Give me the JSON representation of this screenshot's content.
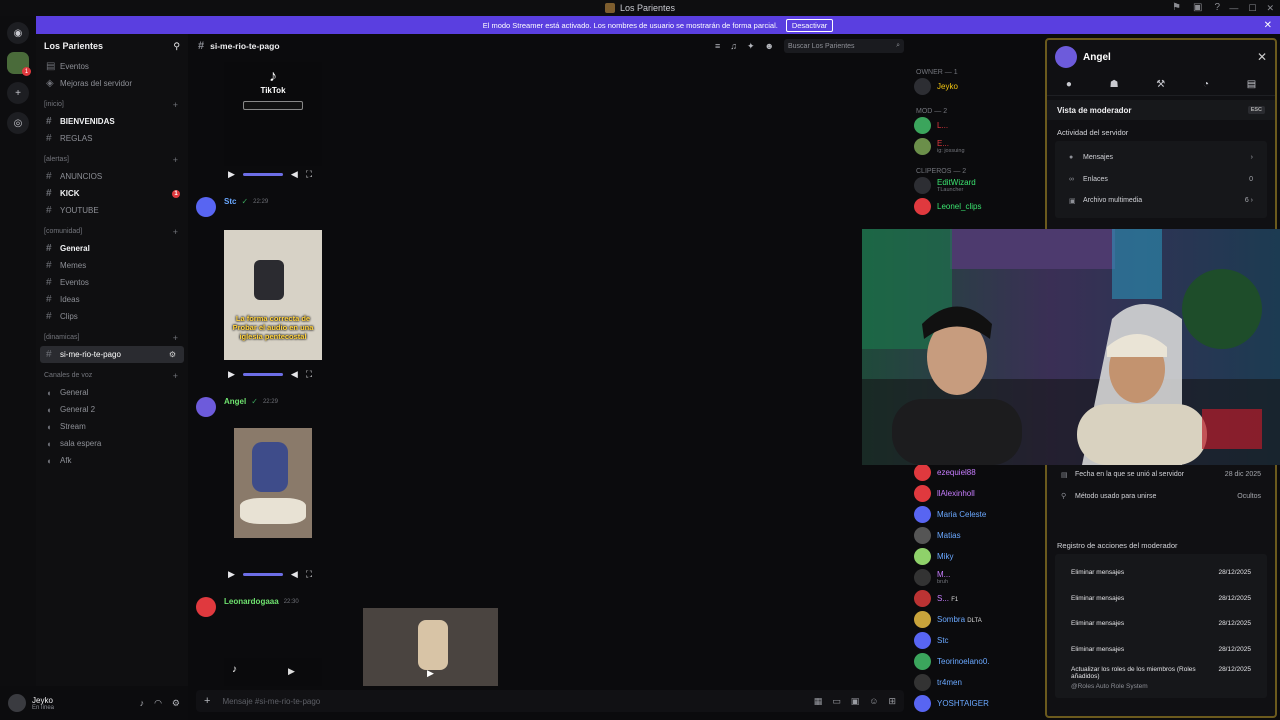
{
  "window": {
    "title": "Los Parientes"
  },
  "banner": {
    "text": "El modo Streamer está activado. Los nombres de usuario se mostrarán de forma parcial.",
    "button": "Desactivar"
  },
  "server": {
    "name": "Los Parientes"
  },
  "sidebar": {
    "top_items": [
      "Eventos",
      "Mejoras del servidor"
    ],
    "categories": [
      {
        "name": "[inicio]",
        "channels": [
          {
            "label": "BIENVENIDAS",
            "unread": true
          },
          {
            "label": "REGLAS",
            "unread": false
          }
        ]
      },
      {
        "name": "[alertas]",
        "channels": [
          {
            "label": "ANUNCIOS",
            "unread": false
          },
          {
            "label": "KICK",
            "unread": true,
            "badge": "1"
          },
          {
            "label": "YOUTUBE",
            "unread": false
          }
        ]
      },
      {
        "name": "[comunidad]",
        "channels": [
          {
            "label": "General",
            "unread": true
          },
          {
            "label": "Memes",
            "unread": false
          },
          {
            "label": "Eventos",
            "unread": false
          },
          {
            "label": "Ideas",
            "unread": false
          },
          {
            "label": "Clips",
            "unread": false
          }
        ]
      },
      {
        "name": "[dinamicas]",
        "channels": [
          {
            "label": "si-me-rio-te-pago",
            "active": true
          }
        ]
      }
    ],
    "voice_header": "Canales de voz",
    "voice_channels": [
      "General",
      "General 2",
      "Stream",
      "sala espera",
      "Afk"
    ]
  },
  "user": {
    "name": "Jeyko",
    "status": "En línea"
  },
  "chat": {
    "channel": "si-me-rio-te-pago",
    "search_placeholder": "Buscar Los Parientes",
    "tiktok_label": "TikTok",
    "caption_1": "La forma correcta de Probar el audio en una iglesia pentecostal",
    "messages": [
      {
        "author": "Stc",
        "time": "22:29"
      },
      {
        "author": "Angel",
        "time": "22:29"
      },
      {
        "author": "Leonardogaaa",
        "time": "22:30"
      }
    ],
    "composer_placeholder": "Mensaje #si-me-rio-te-pago"
  },
  "members": {
    "groups": [
      {
        "name": "OWNER — 1",
        "list": [
          {
            "name": "Jeyko",
            "color": "#f1c40f"
          }
        ]
      },
      {
        "name": "MOD — 2",
        "list": [
          {
            "name": "L...",
            "color": "#e0393e"
          },
          {
            "name": "E...",
            "color": "#e0393e",
            "sub": "ig: jossuing"
          }
        ]
      },
      {
        "name": "CLIPEROS — 2",
        "list": [
          {
            "name": "EditWizard",
            "color": "#3be36f",
            "sub": "TLauncher"
          },
          {
            "name": "Leonel_clips",
            "color": "#3be36f"
          }
        ]
      }
    ],
    "lower": [
      {
        "name": "ezequiel88",
        "color": "#c77dff"
      },
      {
        "name": "llAlexinholl",
        "color": "#c77dff"
      },
      {
        "name": "Maria Celeste",
        "color": "#6aa8ff"
      },
      {
        "name": "Matias",
        "color": "#6aa8ff"
      },
      {
        "name": "Miky",
        "color": "#6aa8ff"
      },
      {
        "name": "M...",
        "color": "#c77dff",
        "sub": "bruh"
      },
      {
        "name": "S...",
        "color": "#c77dff",
        "tag": "F1"
      },
      {
        "name": "Sombra",
        "color": "#6aa8ff",
        "tag": "DLTA"
      },
      {
        "name": "Stc",
        "color": "#6aa8ff"
      },
      {
        "name": "Teorinoelano0.",
        "color": "#6aa8ff"
      },
      {
        "name": "tr4men",
        "color": "#6aa8ff"
      },
      {
        "name": "YOSHTAIGER",
        "color": "#6aa8ff"
      }
    ]
  },
  "modpanel": {
    "user": "Angel",
    "section": "Vista de moderador",
    "esc": "ESC",
    "activity_title": "Actividad del servidor",
    "activity": [
      {
        "label": "Mensajes",
        "value": ""
      },
      {
        "label": "Enlaces",
        "value": "0"
      },
      {
        "label": "Archivo multimedia",
        "value": "6"
      }
    ],
    "info": [
      {
        "label": "Fecha en la que se unió al servidor",
        "value": "28 dic 2025"
      },
      {
        "label": "Método usado para unirse",
        "value": "Ocultos"
      }
    ],
    "log_title": "Registro de acciones del moderador",
    "log": [
      {
        "action": "Eliminar mensajes",
        "date": "28/12/2025"
      },
      {
        "action": "Eliminar mensajes",
        "date": "28/12/2025"
      },
      {
        "action": "Eliminar mensajes",
        "date": "28/12/2025"
      },
      {
        "action": "Eliminar mensajes",
        "date": "28/12/2025"
      },
      {
        "action": "Actualizar los roles de los miembros (Roles añadidos)",
        "date": "28/12/2025",
        "sub": "@Roles Auto Role System"
      }
    ]
  }
}
